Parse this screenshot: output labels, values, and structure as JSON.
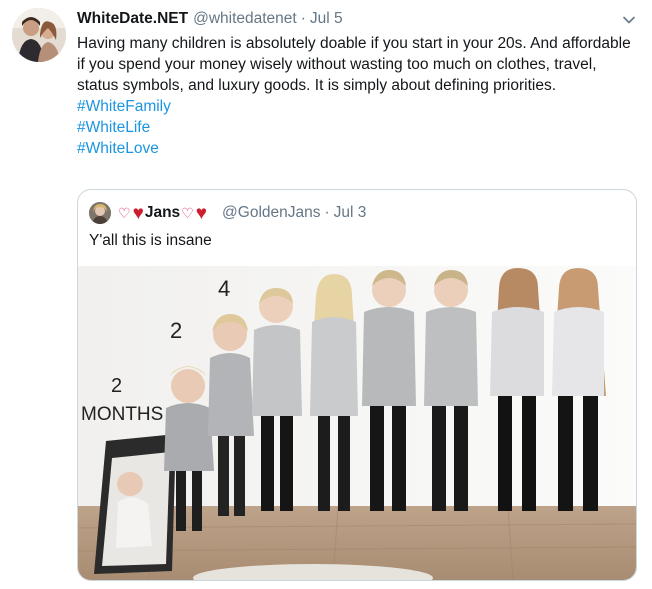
{
  "tweet": {
    "display_name": "WhiteDate.NET",
    "handle": "@whitedatenet",
    "separator": "·",
    "date": "Jul 5",
    "text": "Having many children is absolutely doable if you start in your 20s. And affordable if you spend your money wisely without wasting too much on clothes, travel, status symbols, and luxury goods. It is simply about defining priorities.",
    "hashtags": [
      "#WhiteFamily",
      "#WhiteLife",
      "#WhiteLove"
    ],
    "more_icon": "chevron-down-icon"
  },
  "quoted_tweet": {
    "name_prefix": "♡",
    "name": "Jans",
    "name_mid": "♡",
    "handle": "@GoldenJans",
    "separator": "·",
    "date": "Jul 3",
    "text": "Y'all this is insane",
    "photo": {
      "wall_labels": [
        "4",
        "2",
        "2",
        "MONTHS"
      ]
    }
  },
  "colors": {
    "text": "#14171a",
    "secondary": "#657786",
    "link": "#1b95e0",
    "border": "#ccd6dd",
    "heart": "#cc1f2e"
  }
}
